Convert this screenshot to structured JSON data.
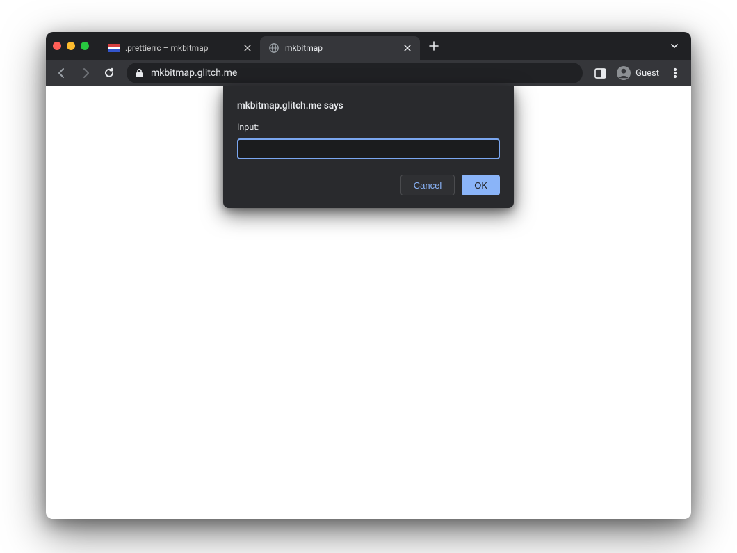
{
  "tabs": [
    {
      "title": ".prettierrc – mkbitmap",
      "active": false
    },
    {
      "title": "mkbitmap",
      "active": true
    }
  ],
  "toolbar": {
    "url": "mkbitmap.glitch.me",
    "guest_label": "Guest"
  },
  "dialog": {
    "title": "mkbitmap.glitch.me says",
    "label": "Input:",
    "input_value": "",
    "cancel_label": "Cancel",
    "ok_label": "OK"
  }
}
